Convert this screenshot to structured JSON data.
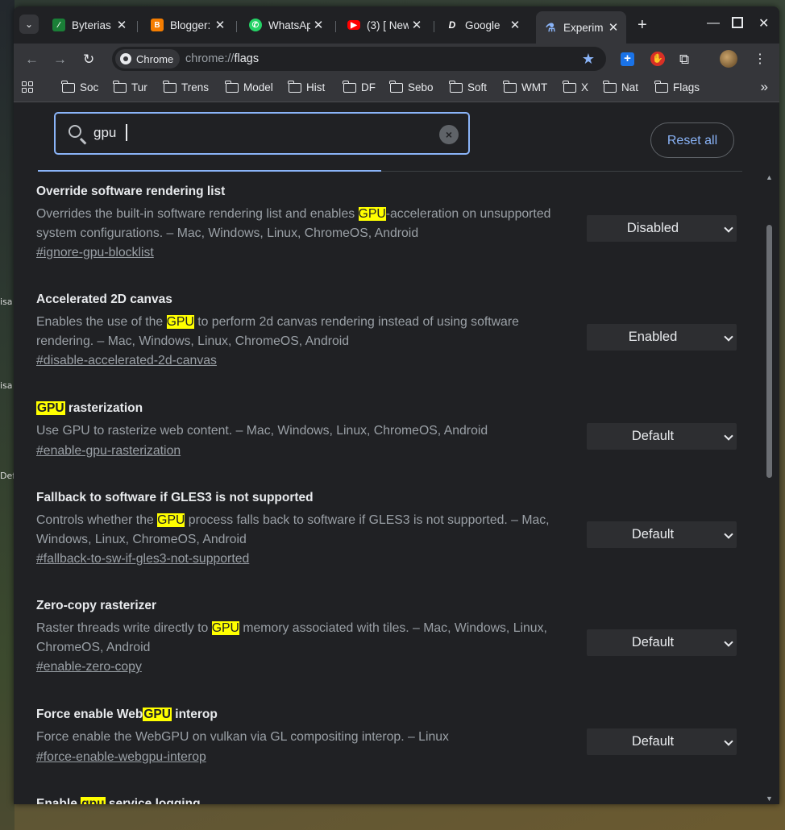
{
  "desktop": {
    "labels": [
      "isa",
      "isa",
      "Defa"
    ]
  },
  "tabs": [
    {
      "title": "Byterias",
      "favicon": "byteria-icon",
      "color": "#1a7f37"
    },
    {
      "title": "Blogger:",
      "favicon": "blogger-icon",
      "color": "#f57d00"
    },
    {
      "title": "WhatsAp",
      "favicon": "whatsapp-icon",
      "color": "#25d366"
    },
    {
      "title": "(3) [ New",
      "favicon": "youtube-icon",
      "color": "#ff0000"
    },
    {
      "title": "Google",
      "favicon": "dazn-icon",
      "color": "#202124"
    },
    {
      "title": "Experim",
      "favicon": "flask-icon",
      "color": "#8ab4f8",
      "active": true
    }
  ],
  "toolbar": {
    "chip_label": "Chrome",
    "url_scheme": "chrome://",
    "url_host": "flags"
  },
  "bookmarks": [
    "Soc",
    "Tur",
    "Trens",
    "Model",
    "Hist",
    "DF",
    "Sebo",
    "Soft",
    "WMT",
    "X",
    "Nat",
    "Flags"
  ],
  "search": {
    "value": "gpu"
  },
  "reset_label": "Reset all",
  "flags": [
    {
      "name": "Override software rendering list",
      "desc_parts": [
        "Overrides the built-in software rendering list and enables ",
        "GPU",
        "-acceleration on unsupported system configurations. – Mac, Windows, Linux, ChromeOS, Android"
      ],
      "link": "#ignore-gpu-blocklist",
      "value": "Disabled"
    },
    {
      "name": "Accelerated 2D canvas",
      "desc_parts": [
        "Enables the use of the ",
        "GPU",
        " to perform 2d canvas rendering instead of using software rendering. – Mac, Windows, Linux, ChromeOS, Android"
      ],
      "link": "#disable-accelerated-2d-canvas",
      "value": "Enabled"
    },
    {
      "name_parts": [
        "",
        "GPU",
        " rasterization"
      ],
      "desc": "Use GPU to rasterize web content. – Mac, Windows, Linux, ChromeOS, Android",
      "link": "#enable-gpu-rasterization",
      "value": "Default"
    },
    {
      "name": "Fallback to software if GLES3 is not supported",
      "desc_parts": [
        "Controls whether the ",
        "GPU",
        " process falls back to software if GLES3 is not supported. – Mac, Windows, Linux, ChromeOS, Android"
      ],
      "link": "#fallback-to-sw-if-gles3-not-supported",
      "value": "Default"
    },
    {
      "name": "Zero-copy rasterizer",
      "desc_parts": [
        "Raster threads write directly to ",
        "GPU",
        " memory associated with tiles. – Mac, Windows, Linux, ChromeOS, Android"
      ],
      "link": "#enable-zero-copy",
      "value": "Default"
    },
    {
      "name_parts": [
        "Force enable Web",
        "GPU",
        " interop"
      ],
      "desc": "Force enable the WebGPU on vulkan via GL compositing interop. – Linux",
      "link": "#force-enable-webgpu-interop",
      "value": "Default"
    },
    {
      "name_parts": [
        "Enable ",
        "gpu",
        " service logging"
      ]
    }
  ]
}
